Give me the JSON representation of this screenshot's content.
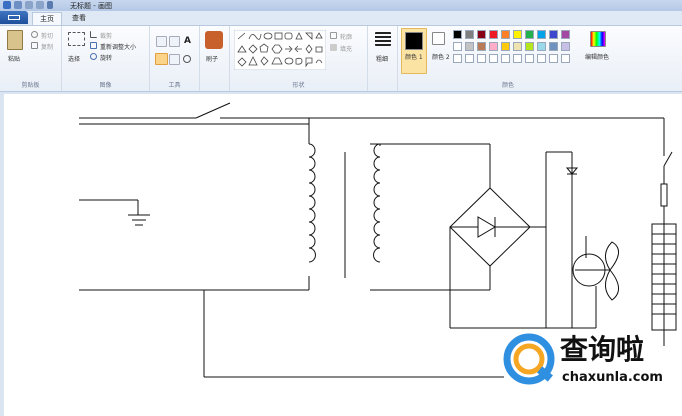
{
  "window": {
    "title": "无标题 - 画图"
  },
  "tabs": [
    {
      "label": "主页"
    },
    {
      "label": "查看"
    }
  ],
  "clipboard": {
    "paste": "粘贴",
    "cut": "剪切",
    "copy": "复制",
    "group": "剪贴板"
  },
  "image": {
    "select": "选择",
    "crop": "裁剪",
    "resize": "重新调整大小",
    "rotate": "旋转",
    "group": "图像"
  },
  "tools": {
    "group": "工具"
  },
  "brushes": {
    "label": "刷子"
  },
  "shapes": {
    "outline": "轮廓",
    "fill": "填充",
    "group": "形状"
  },
  "size": {
    "label": "粗细"
  },
  "colors": {
    "color1_label": "颜色 1",
    "color2_label": "颜色 2",
    "edit_label": "编辑颜色",
    "group": "颜色",
    "color1": "#000000",
    "color2": "#ffffff",
    "palette_row1": [
      "#000000",
      "#7f7f7f",
      "#880015",
      "#ed1c24",
      "#ff7f27",
      "#fff200",
      "#22b14c",
      "#00a2e8",
      "#3f48cc",
      "#a349a4"
    ],
    "palette_row2": [
      "#ffffff",
      "#c3c3c3",
      "#b97a57",
      "#ffaec9",
      "#ffc90e",
      "#efe4b0",
      "#b5e61d",
      "#99d9ea",
      "#7092be",
      "#c8bfe7"
    ]
  },
  "watermark": {
    "brand": "查询啦",
    "url": "chaxunla.com"
  }
}
